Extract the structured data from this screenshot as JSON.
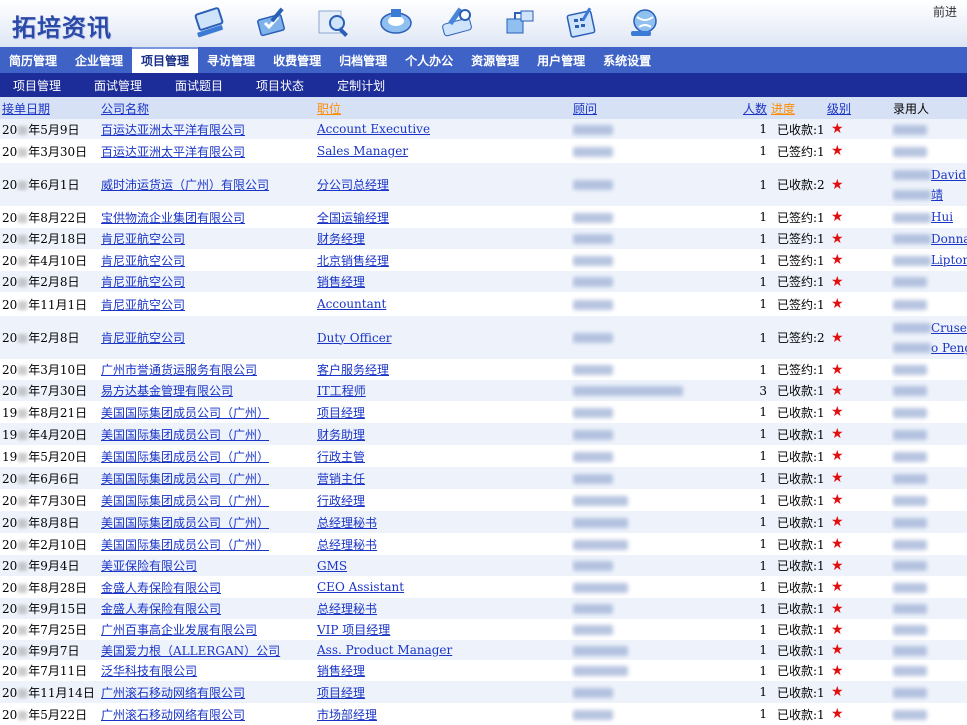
{
  "app": {
    "logo": "拓培资讯",
    "forward": "前进"
  },
  "toolbar_icons": [
    "computer-icon",
    "pen-check-icon",
    "magnify-document-icon",
    "disk-icon",
    "tools-icon",
    "network-icon",
    "calculator-icon",
    "globe-icon"
  ],
  "main_nav": [
    "简历管理",
    "企业管理",
    "项目管理",
    "寻访管理",
    "收费管理",
    "归档管理",
    "个人办公",
    "资源管理",
    "用户管理",
    "系统设置"
  ],
  "main_nav_active": 2,
  "sub_nav": [
    "项目管理",
    "面试管理",
    "面试题目",
    "项目状态",
    "定制计划"
  ],
  "table": {
    "headers": {
      "date": "接单日期",
      "company": "公司名称",
      "position": "职位",
      "consultant": "顾问",
      "count": "人数",
      "progress": "进度",
      "level": "级别",
      "hirer": "录用人"
    },
    "rows": [
      {
        "y1": "20",
        "date": "年5月9日",
        "company": "百运达亚洲太平洋有限公司",
        "position": "Account Executive",
        "count": "1",
        "progress": "已收款:1",
        "hirer": [
          ""
        ],
        "h": 19
      },
      {
        "y1": "20",
        "date": "年3月30日",
        "company": "百运达亚洲太平洋有限公司",
        "position": "Sales Manager",
        "count": "1",
        "progress": "已签约:1",
        "hirer": [
          ""
        ],
        "h": 24
      },
      {
        "y1": "20",
        "date": "年6月1日",
        "company": "威时沛运货运（广州）有限公司",
        "position": "分公司总经理",
        "count": "1",
        "progress": "已收款:2",
        "hirer": [
          "David",
          "靖"
        ],
        "h": 43
      },
      {
        "y1": "20",
        "date": "年8月22日",
        "company": "宝供物流企业集团有限公司",
        "position": "全国运输经理",
        "count": "1",
        "progress": "已签约:1",
        "hirer": [
          "Hui"
        ],
        "h": 22
      },
      {
        "y1": "20",
        "date": "年2月18日",
        "company": "肯尼亚航空公司",
        "position": "财务经理",
        "count": "1",
        "progress": "已签约:1",
        "hirer": [
          "Donna"
        ],
        "h": 21
      },
      {
        "y1": "20",
        "date": "年4月10日",
        "company": "肯尼亚航空公司",
        "position": "北京销售经理",
        "count": "1",
        "progress": "已签约:1",
        "hirer": [
          "Lipton"
        ],
        "h": 22
      },
      {
        "y1": "20",
        "date": "年2月8日",
        "company": "肯尼亚航空公司",
        "position": "销售经理",
        "count": "1",
        "progress": "已签约:1",
        "hirer": [
          ""
        ],
        "h": 21
      },
      {
        "y1": "20",
        "date": "年11月1日",
        "company": "肯尼亚航空公司",
        "position": "Accountant",
        "count": "1",
        "progress": "已签约:1",
        "hirer": [
          ""
        ],
        "h": 24
      },
      {
        "y1": "20",
        "date": "年2月8日",
        "company": "肯尼亚航空公司",
        "position": "Duty Officer",
        "count": "1",
        "progress": "已签约:2",
        "hirer": [
          "Cruse",
          "o Peng"
        ],
        "h": 43
      },
      {
        "y1": "20",
        "date": "年3月10日",
        "company": "广州市誉通货运服务有限公司",
        "position": "客户服务经理",
        "count": "1",
        "progress": "已签约:1",
        "hirer": [
          ""
        ],
        "h": 21
      },
      {
        "y1": "20",
        "date": "年7月30日",
        "company": "易方达基金管理有限公司",
        "position": "IT工程师",
        "count": "3",
        "progress": "已收款:1",
        "hirer": [
          ""
        ],
        "h": 21
      },
      {
        "y1": "19",
        "date": "年8月21日",
        "company": "美国国际集团成员公司（广州）",
        "position": "项目经理",
        "count": "1",
        "progress": "已收款:1",
        "hirer": [
          ""
        ],
        "h": 22
      },
      {
        "y1": "19",
        "date": "年4月20日",
        "company": "美国国际集团成员公司（广州）",
        "position": "财务助理",
        "count": "1",
        "progress": "已收款:1",
        "hirer": [
          ""
        ],
        "h": 22
      },
      {
        "y1": "19",
        "date": "年5月20日",
        "company": "美国国际集团成员公司（广州）",
        "position": "行政主管",
        "count": "1",
        "progress": "已收款:1",
        "hirer": [
          ""
        ],
        "h": 22
      },
      {
        "y1": "20",
        "date": "年6月6日",
        "company": "美国国际集团成员公司（广州）",
        "position": "营销主任",
        "count": "1",
        "progress": "已收款:1",
        "hirer": [
          ""
        ],
        "h": 22
      },
      {
        "y1": "20",
        "date": "年7月30日",
        "company": "美国国际集团成员公司（广州）",
        "position": "行政经理",
        "count": "1",
        "progress": "已收款:1",
        "hirer": [
          ""
        ],
        "h": 22
      },
      {
        "y1": "20",
        "date": "年8月8日",
        "company": "美国国际集团成员公司（广州）",
        "position": "总经理秘书",
        "count": "1",
        "progress": "已收款:1",
        "hirer": [
          ""
        ],
        "h": 22
      },
      {
        "y1": "20",
        "date": "年2月10日",
        "company": "美国国际集团成员公司（广州）",
        "position": "总经理秘书",
        "count": "1",
        "progress": "已收款:1",
        "hirer": [
          ""
        ],
        "h": 22
      },
      {
        "y1": "20",
        "date": "年9月4日",
        "company": "美亚保险有限公司",
        "position": "GMS",
        "count": "1",
        "progress": "已收款:1",
        "hirer": [
          ""
        ],
        "h": 21
      },
      {
        "y1": "20",
        "date": "年8月28日",
        "company": "金盛人寿保险有限公司",
        "position": "CEO Assistant",
        "count": "1",
        "progress": "已收款:1",
        "hirer": [
          ""
        ],
        "h": 22
      },
      {
        "y1": "20",
        "date": "年9月15日",
        "company": "金盛人寿保险有限公司",
        "position": "总经理秘书",
        "count": "1",
        "progress": "已收款:1",
        "hirer": [
          ""
        ],
        "h": 21
      },
      {
        "y1": "20",
        "date": "年7月25日",
        "company": "广州百事高企业发展有限公司",
        "position": "VIP 项目经理",
        "count": "1",
        "progress": "已收款:1",
        "hirer": [
          ""
        ],
        "h": 21
      },
      {
        "y1": "20",
        "date": "年9月7日",
        "company": "美国爱力根（ALLERGAN）公司",
        "position": "Ass. Product Manager",
        "count": "1",
        "progress": "已收款:1",
        "hirer": [
          ""
        ],
        "h": 17
      },
      {
        "y1": "20",
        "date": "年7月11日",
        "company": "泛华科技有限公司",
        "position": "销售经理",
        "count": "1",
        "progress": "已收款:1",
        "hirer": [
          ""
        ],
        "h": 21
      },
      {
        "y1": "20",
        "date": "年11月14日",
        "company": "广州滚石移动网络有限公司",
        "position": "项目经理",
        "count": "1",
        "progress": "已收款:1",
        "hirer": [
          ""
        ],
        "h": 22
      },
      {
        "y1": "20",
        "date": "年5月22日",
        "company": "广州滚石移动网络有限公司",
        "position": "市场部经理",
        "count": "1",
        "progress": "已收款:1",
        "hirer": [
          ""
        ],
        "h": 22
      }
    ]
  }
}
